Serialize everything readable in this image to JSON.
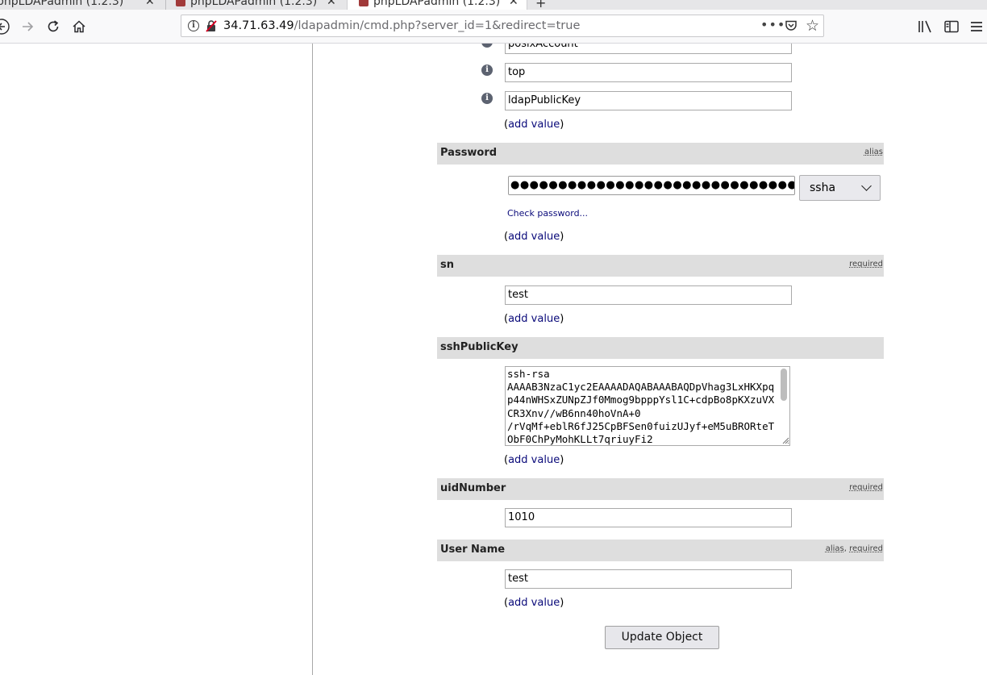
{
  "browser": {
    "tabs": [
      {
        "title": "phpLDAPadmin (1.2.3)"
      },
      {
        "title": "phpLDAPadmin (1.2.3)"
      },
      {
        "title": "phpLDAPadmin (1.2.3)"
      }
    ],
    "url_host": "34.71.63.49",
    "url_path": "/ldapadmin/cmd.php?server_id=1&redirect=true"
  },
  "form": {
    "objectclass_values": [
      "posixAccount",
      "top",
      "ldapPublicKey"
    ],
    "add_value_label": "add value",
    "password": {
      "label": "Password",
      "tag": "alias",
      "masked_value": "●●●●●●●●●●●●●●●●●●●●●●●●●●●●●●●●●●●●●●●●●●●●",
      "hash_type": "ssha",
      "check_label": "Check password..."
    },
    "sn": {
      "label": "sn",
      "tag": "required",
      "value": "test"
    },
    "sshPublicKey": {
      "label": "sshPublicKey",
      "value": "ssh-rsa\nAAAAB3NzaC1yc2EAAAADAQABAAABAQDpVhag3LxHKXpqp44nWHSxZUNpZJf0Mmog9bpppYsl1C+cdpBo8pKXzuVXCR3Xnv//wB6nn40hoVnA+0\n/rVqMf+eblR6fJ25CpBFSen0fuizUJyf+eM5uBRORteTObF0ChPyMohKLLt7qriuyFi2"
    },
    "uidNumber": {
      "label": "uidNumber",
      "tag": "required",
      "value": "1010"
    },
    "username": {
      "label": "User Name",
      "tag_alias": "alias",
      "tag_required": "required",
      "value": "test"
    },
    "submit_label": "Update Object"
  }
}
